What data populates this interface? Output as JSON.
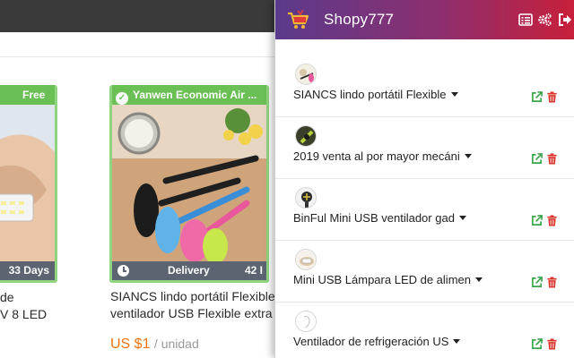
{
  "store": {
    "cards": [
      {
        "badge": "Free",
        "footer_label": "33 Days",
        "title_lines": [
          "de",
          "V 8 LED"
        ]
      },
      {
        "badge": "Yanwen Economic Air ...",
        "footer_label": "Delivery",
        "footer_value": "42 I",
        "title_lines": [
          "SIANCS lindo portátil Flexible",
          "ventilador USB Flexible extra"
        ],
        "price": "US $1",
        "unit": "/ unidad"
      }
    ]
  },
  "popup": {
    "title": "Shopy777",
    "header_icons": [
      "list-icon",
      "gears-icon",
      "sign-out-icon"
    ],
    "colors": {
      "header_start": "#5b3a8c",
      "header_end": "#c81f3a",
      "open_link": "#3aa64a",
      "delete": "#d9342b"
    },
    "products": [
      {
        "name": "SIANCS lindo portátil Flexible"
      },
      {
        "name": "2019 venta al por mayor mecáni"
      },
      {
        "name": "BinFul Mini USB ventilador gad"
      },
      {
        "name": "Mini USB Lámpara LED de alimen"
      },
      {
        "name": "Ventilador de refrigeración US"
      }
    ]
  }
}
